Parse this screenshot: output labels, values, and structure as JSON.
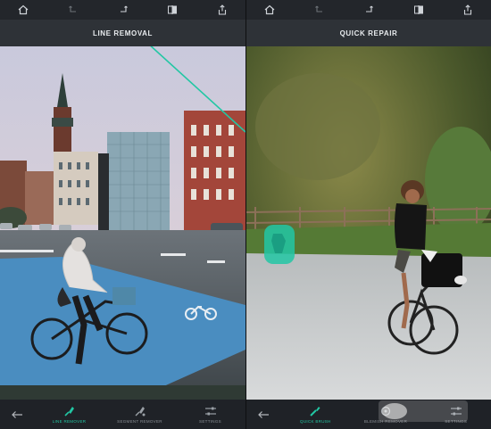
{
  "left_panel": {
    "title": "LINE REMOVAL",
    "tools": [
      {
        "label": "LINE REMOVER",
        "icon": "line-remover-icon",
        "active": true
      },
      {
        "label": "SEGMENT REMOVER",
        "icon": "segment-remover-icon",
        "active": false
      },
      {
        "label": "SETTINGS",
        "icon": "sliders-icon",
        "active": false
      }
    ]
  },
  "right_panel": {
    "title": "QUICK REPAIR",
    "tools": [
      {
        "label": "QUICK BRUSH",
        "icon": "quick-brush-icon",
        "active": true
      },
      {
        "label": "BLEMISH REMOVER",
        "icon": "blemish-remover-icon",
        "active": false
      },
      {
        "label": "SETTINGS",
        "icon": "sliders-icon",
        "active": false
      }
    ]
  },
  "topbar_icons": [
    "home-icon",
    "undo-icon",
    "redo-icon",
    "compare-icon",
    "share-icon"
  ],
  "colors": {
    "accent": "#22c7a4",
    "toolbar_bg": "#23262b",
    "title_bar_bg": "#30343a"
  }
}
